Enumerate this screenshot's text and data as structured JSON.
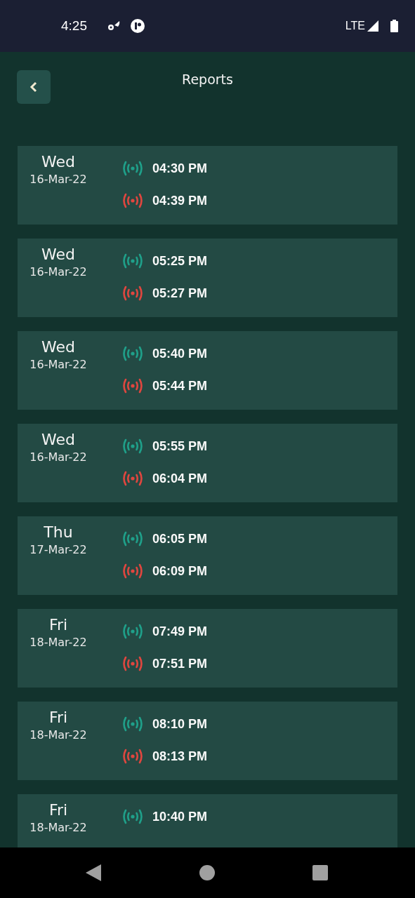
{
  "status_bar": {
    "time": "4:25",
    "network": "LTE"
  },
  "header": {
    "title": "Reports"
  },
  "reports": [
    {
      "day": "Wed",
      "date": "16-Mar-22",
      "times": [
        {
          "kind": "start",
          "time": "04:30 PM"
        },
        {
          "kind": "end",
          "time": "04:39 PM"
        }
      ]
    },
    {
      "day": "Wed",
      "date": "16-Mar-22",
      "times": [
        {
          "kind": "start",
          "time": "05:25 PM"
        },
        {
          "kind": "end",
          "time": "05:27 PM"
        }
      ]
    },
    {
      "day": "Wed",
      "date": "16-Mar-22",
      "times": [
        {
          "kind": "start",
          "time": "05:40 PM"
        },
        {
          "kind": "end",
          "time": "05:44 PM"
        }
      ]
    },
    {
      "day": "Wed",
      "date": "16-Mar-22",
      "times": [
        {
          "kind": "start",
          "time": "05:55 PM"
        },
        {
          "kind": "end",
          "time": "06:04 PM"
        }
      ]
    },
    {
      "day": "Thu",
      "date": "17-Mar-22",
      "times": [
        {
          "kind": "start",
          "time": "06:05 PM"
        },
        {
          "kind": "end",
          "time": "06:09 PM"
        }
      ]
    },
    {
      "day": "Fri",
      "date": "18-Mar-22",
      "times": [
        {
          "kind": "start",
          "time": "07:49 PM"
        },
        {
          "kind": "end",
          "time": "07:51 PM"
        }
      ]
    },
    {
      "day": "Fri",
      "date": "18-Mar-22",
      "times": [
        {
          "kind": "start",
          "time": "08:10 PM"
        },
        {
          "kind": "end",
          "time": "08:13 PM"
        }
      ]
    },
    {
      "day": "Fri",
      "date": "18-Mar-22",
      "times": [
        {
          "kind": "start",
          "time": "10:40 PM"
        }
      ]
    }
  ]
}
